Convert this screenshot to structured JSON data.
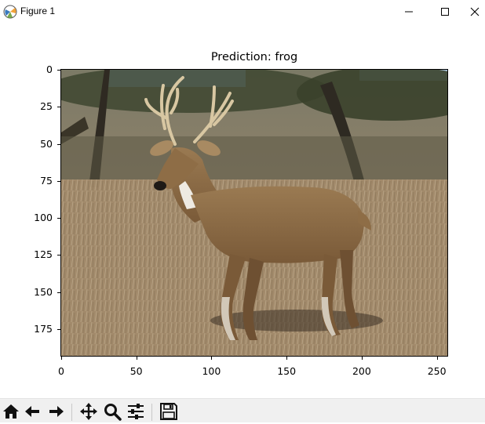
{
  "window": {
    "title": "Figure 1",
    "icons": {
      "app": "matplotlib-icon",
      "minimize": "minimize-icon",
      "maximize": "maximize-icon",
      "close": "close-icon"
    }
  },
  "plot": {
    "title": "Prediction: frog",
    "image_subject": "white-tailed buck deer standing in dry grass",
    "image_width": 258,
    "image_height": 194,
    "y_ticks": [
      0,
      25,
      50,
      75,
      100,
      125,
      150,
      175
    ],
    "x_ticks": [
      0,
      50,
      100,
      150,
      200,
      250
    ],
    "y_tick_labels": [
      "0",
      "25",
      "50",
      "75",
      "100",
      "125",
      "150",
      "175"
    ],
    "x_tick_labels": [
      "0",
      "50",
      "100",
      "150",
      "200",
      "250"
    ]
  },
  "toolbar": {
    "items": [
      {
        "name": "home-icon"
      },
      {
        "name": "back-icon"
      },
      {
        "name": "forward-icon"
      },
      {
        "name": "pan-icon"
      },
      {
        "name": "zoom-icon"
      },
      {
        "name": "configure-subplots-icon"
      },
      {
        "name": "save-icon"
      }
    ]
  },
  "colors": {
    "toolbar_bg": "#f0f0f0",
    "sky": "#9fc4e4",
    "grass": "#a08a6b",
    "deer_body": "#8a6a45"
  }
}
